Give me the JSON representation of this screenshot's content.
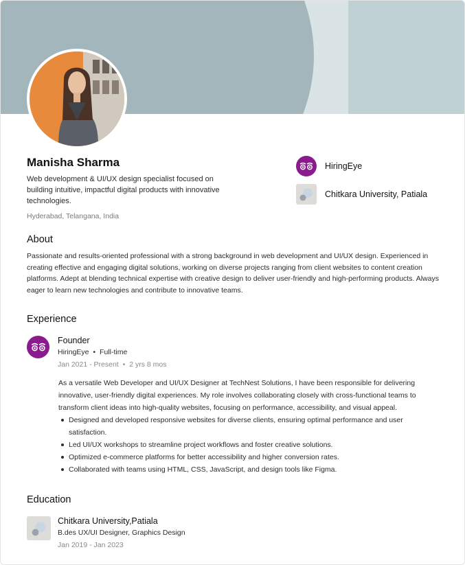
{
  "profile": {
    "name": "Manisha Sharma",
    "headline": "Web development & UI/UX design specialist focused on building intuitive, impactful digital products with innovative technologies.",
    "location": "Hyderabad, Telangana, India",
    "avatar_icon": "profile-photo"
  },
  "organizations": [
    {
      "label": "HiringEye",
      "icon": "hiringeye-logo"
    },
    {
      "label": "Chitkara University, Patiala",
      "icon": "university-logo"
    }
  ],
  "about": {
    "title": "About",
    "text": "Passionate and results-oriented professional with a strong background in web development and UI/UX design. Experienced in creating effective and engaging digital solutions, working on diverse projects ranging from client websites to content creation platforms. Adept at blending technical expertise with creative design to deliver user-friendly and high-performing products. Always eager to learn new technologies and contribute to innovative teams."
  },
  "experience": {
    "title": "Experience",
    "items": [
      {
        "role": "Founder",
        "company": "HiringEye",
        "employment_type": "Full-time",
        "dates": "Jan 2021 - Present",
        "duration": "2 yrs 8 mos",
        "description": "As a versatile Web Developer and UI/UX Designer at TechNest Solutions, I have been responsible for delivering innovative, user-friendly digital experiences. My role involves collaborating closely with cross-functional teams to transform client ideas into high-quality websites, focusing on performance, accessibility, and visual appeal.",
        "bullets": [
          "Designed and developed responsive websites for diverse clients, ensuring optimal performance and user satisfaction.",
          "Led UI/UX workshops to streamline project workflows and foster creative solutions.",
          "Optimized e-commerce platforms for better accessibility and higher conversion rates.",
          "Collaborated with teams using HTML, CSS, JavaScript, and design tools like Figma."
        ]
      }
    ]
  },
  "education": {
    "title": "Education",
    "items": [
      {
        "school": "Chitkara University,Patiala",
        "degree": "B.des UX/UI Designer, Graphics Design",
        "dates": "Jan 2019 - Jan 2023"
      }
    ]
  },
  "colors": {
    "cover_primary": "#a3b6bb",
    "cover_secondary": "#bfd1d5",
    "brand_purple": "#8b1a8e"
  }
}
